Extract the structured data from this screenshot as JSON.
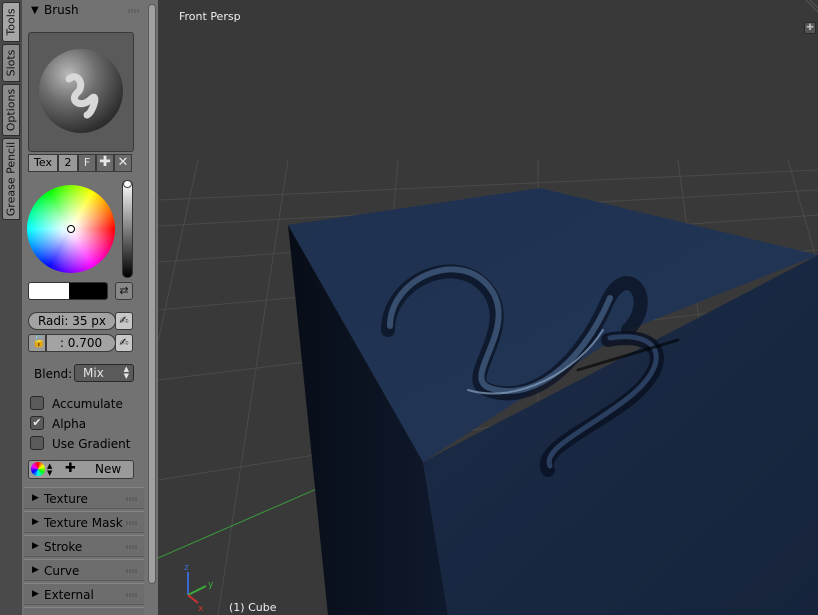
{
  "tabs": [
    "Tools",
    "Slots",
    "Options",
    "Grease Pencil"
  ],
  "brush_panel": {
    "title": "Brush",
    "tex_label": "Tex",
    "user_count": "2",
    "fake_user": "F",
    "add_icon": "plus-icon",
    "remove_icon": "x-icon"
  },
  "color": {
    "primary": "#ffffff",
    "secondary": "#000000"
  },
  "radius": {
    "label": "Radi:",
    "value": "35 px"
  },
  "strength": {
    "value": ": 0.700"
  },
  "blend": {
    "label": "Blend:",
    "value": "Mix"
  },
  "options": [
    {
      "label": "Accumulate",
      "checked": false
    },
    {
      "label": "Alpha",
      "checked": true
    },
    {
      "label": "Use Gradient",
      "checked": false
    }
  ],
  "palette": {
    "new_label": "New"
  },
  "subpanels": [
    "Texture",
    "Texture Mask",
    "Stroke",
    "Curve",
    "External"
  ],
  "viewport": {
    "view_name": "Front Persp",
    "object_label": "(1) Cube",
    "axis_colors": {
      "x": "#cc3333",
      "y": "#33aa33",
      "z": "#3366cc"
    },
    "cube_color": "#1f3150"
  }
}
